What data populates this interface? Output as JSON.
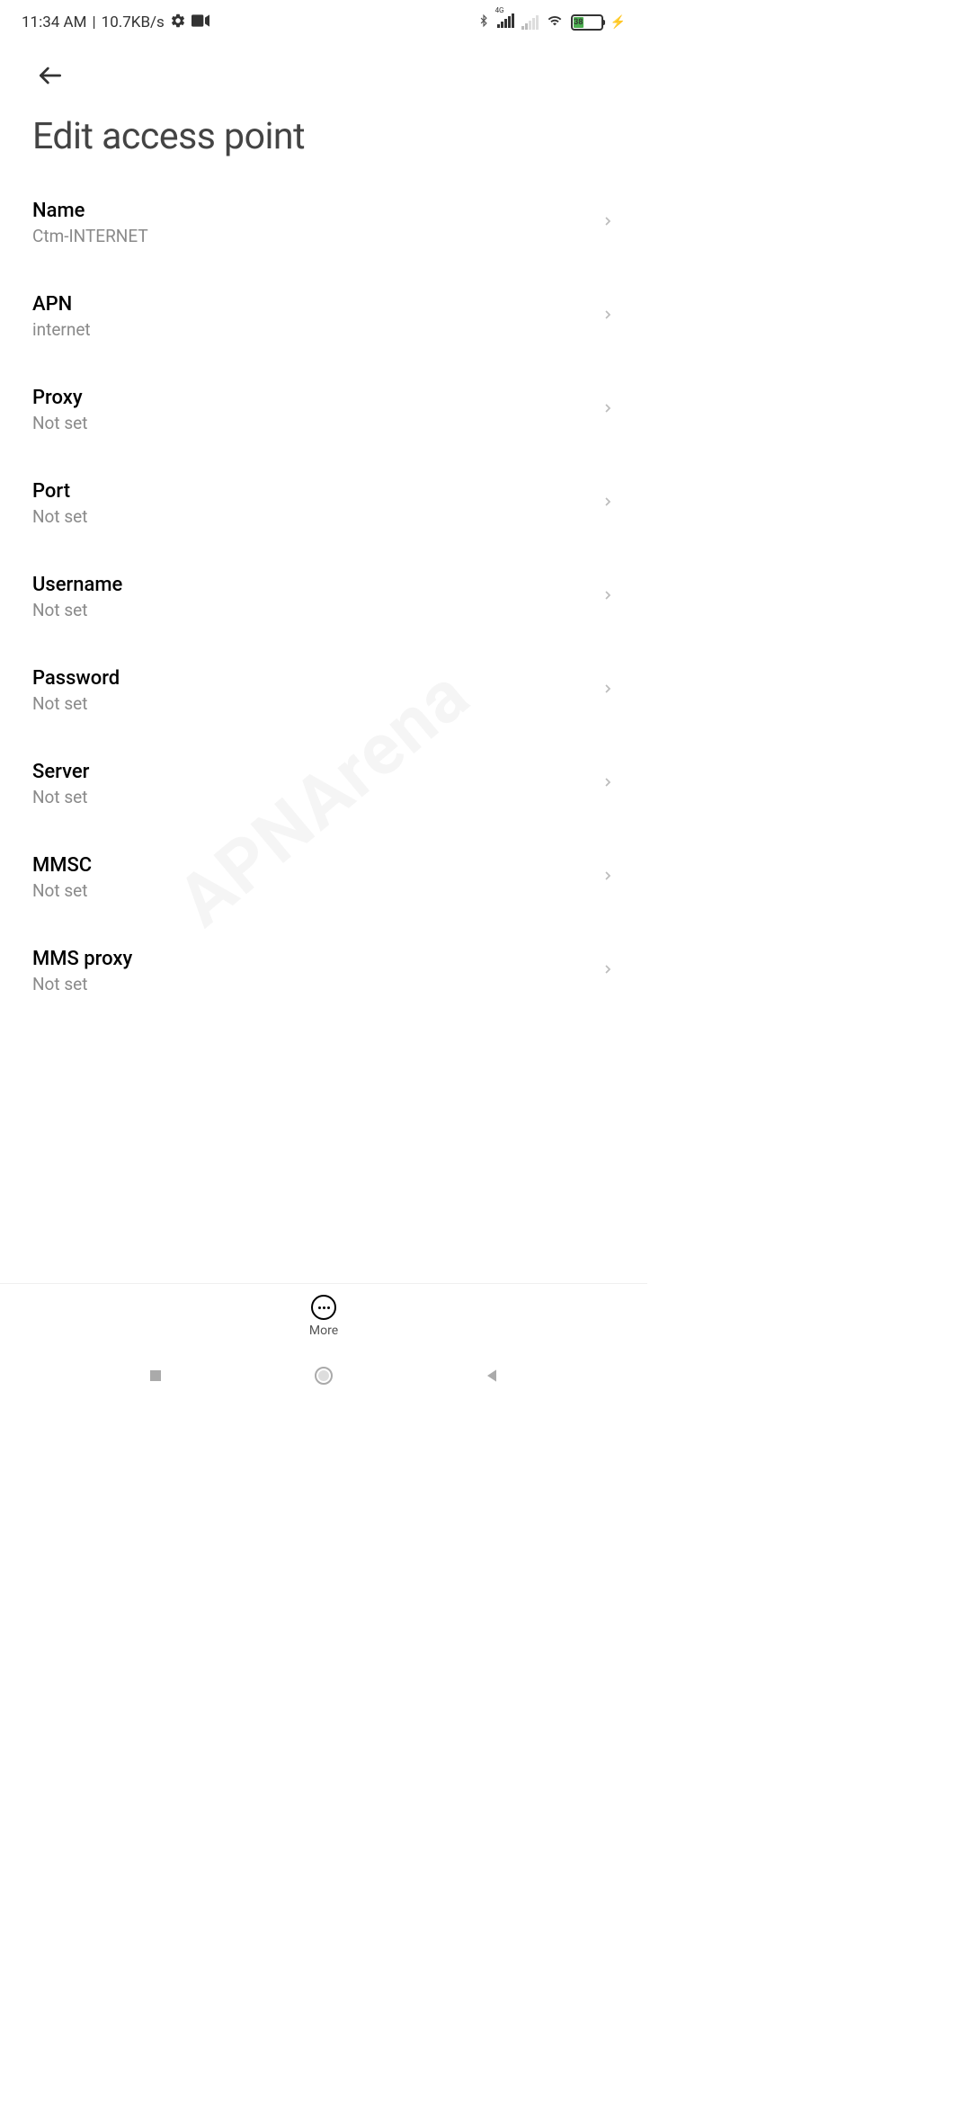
{
  "statusBar": {
    "time": "11:34 AM",
    "speed": "10.7KB/s",
    "networkLabel": "4G",
    "batteryPercent": "38"
  },
  "page": {
    "title": "Edit access point"
  },
  "settings": [
    {
      "title": "Name",
      "value": "Ctm-INTERNET"
    },
    {
      "title": "APN",
      "value": "internet"
    },
    {
      "title": "Proxy",
      "value": "Not set"
    },
    {
      "title": "Port",
      "value": "Not set"
    },
    {
      "title": "Username",
      "value": "Not set"
    },
    {
      "title": "Password",
      "value": "Not set"
    },
    {
      "title": "Server",
      "value": "Not set"
    },
    {
      "title": "MMSC",
      "value": "Not set"
    },
    {
      "title": "MMS proxy",
      "value": "Not set"
    }
  ],
  "bottomBar": {
    "moreLabel": "More"
  },
  "watermark": "APNArena"
}
